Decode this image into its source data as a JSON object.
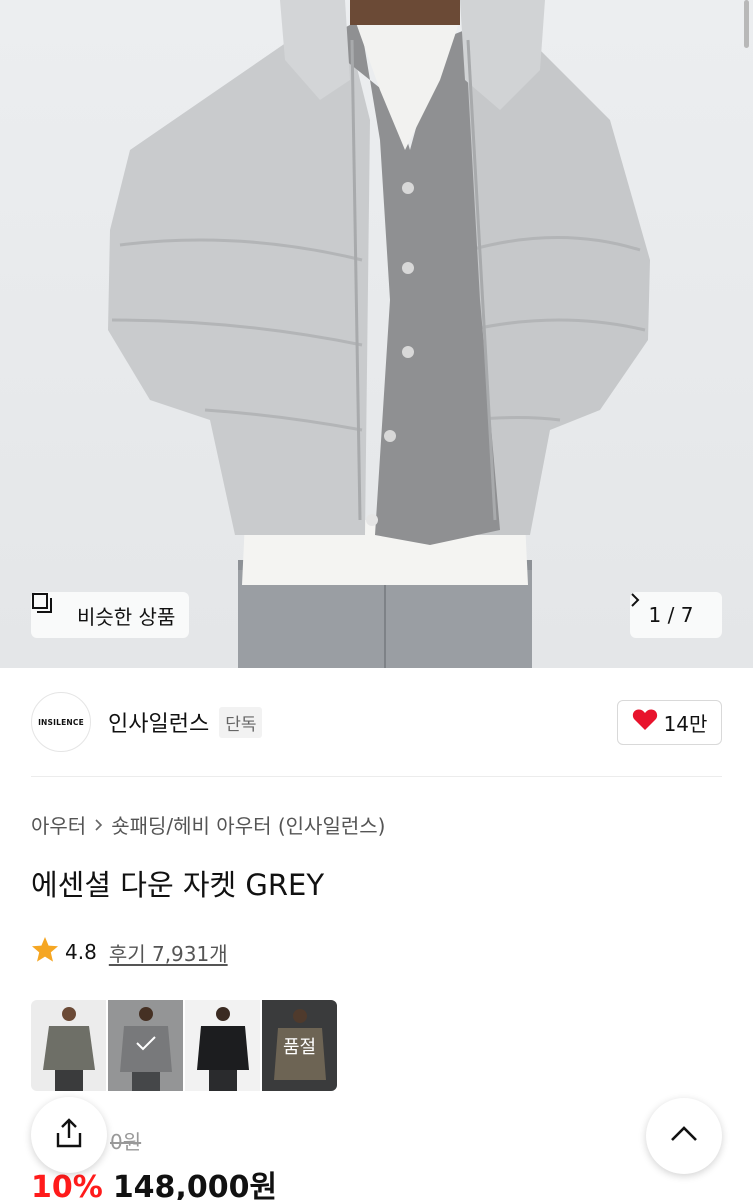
{
  "hero": {
    "similar_label": "비슷한 상품",
    "counter": "1 / 7"
  },
  "brand": {
    "logo_text": "INSILENCE",
    "name": "인사일런스",
    "tag": "단독",
    "likes": "14만"
  },
  "product": {
    "breadcrumb": [
      "아우터",
      "숏패딩/헤비 아우터 (인사일런스)"
    ],
    "title": "에센셜 다운 자켓 GREY",
    "rating": "4.8",
    "reviews": "후기 7,931개",
    "thumbnails": [
      {
        "color_name": "khaki-grey",
        "selected": false,
        "overlay": ""
      },
      {
        "color_name": "grey",
        "selected": true,
        "overlay": ""
      },
      {
        "color_name": "black",
        "selected": false,
        "overlay": ""
      },
      {
        "color_name": "beige",
        "selected": false,
        "overlay": "품절"
      }
    ],
    "original_price": "0원",
    "discount": "10%",
    "price": "148,000원"
  },
  "colors": {
    "discount": "#ff1b1b",
    "heart": "#e8132c",
    "star": "#f5a623"
  }
}
